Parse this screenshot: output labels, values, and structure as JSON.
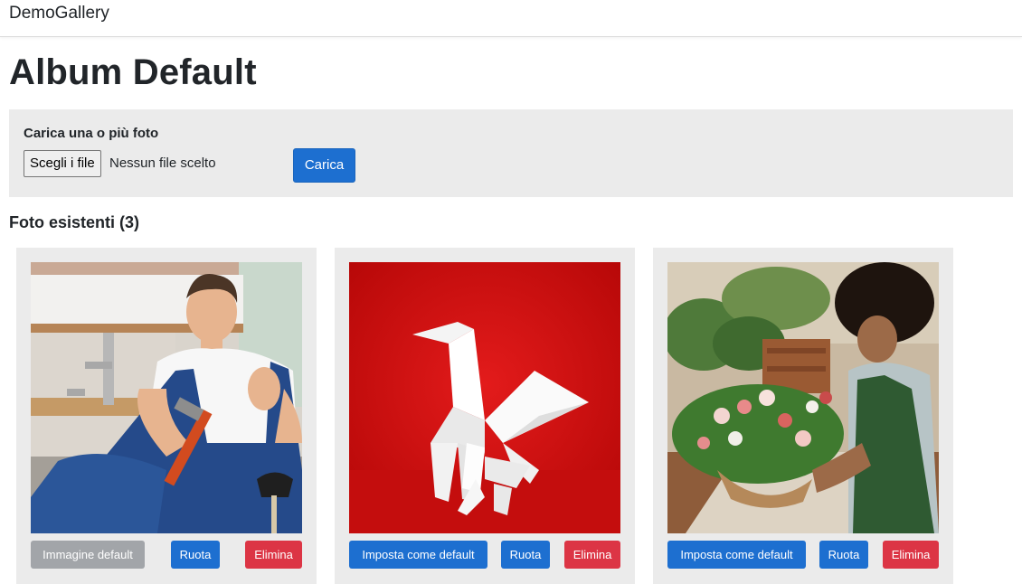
{
  "navbar": {
    "brand": "DemoGallery"
  },
  "page": {
    "title": "Album Default"
  },
  "upload": {
    "label": "Carica una o più foto",
    "file_button": "Scegli i file",
    "file_status": "Nessun file scelto",
    "submit_label": "Carica"
  },
  "photos": {
    "heading": "Foto esistenti (3)",
    "items": [
      {
        "image": "plumber-photo",
        "default_label": "Immagine default",
        "rotate_label": "Ruota",
        "delete_label": "Elimina"
      },
      {
        "image": "origami-photo",
        "default_label": "Imposta come default",
        "rotate_label": "Ruota",
        "delete_label": "Elimina"
      },
      {
        "image": "florist-photo",
        "default_label": "Imposta come default",
        "rotate_label": "Ruota",
        "delete_label": "Elimina"
      }
    ]
  },
  "colors": {
    "primary": "#1d6fd0",
    "secondary": "#a2a5a9",
    "danger": "#dc3545",
    "panel": "#ebebeb"
  }
}
